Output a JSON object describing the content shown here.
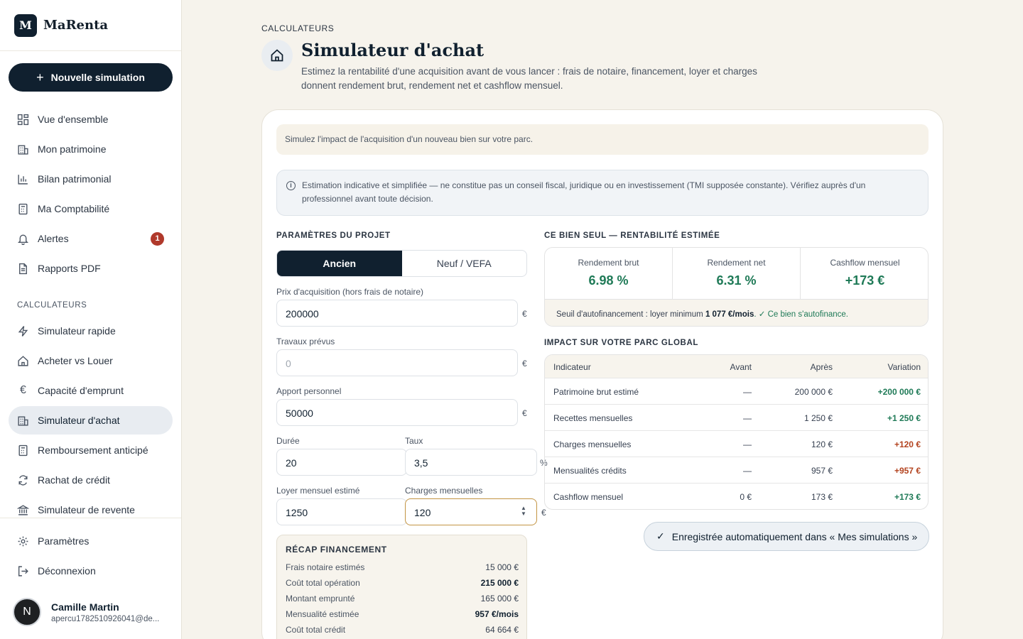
{
  "app": {
    "brand_letter": "M",
    "brand_name": "MaRenta"
  },
  "sidebar": {
    "new_button": "Nouvelle simulation",
    "items": [
      {
        "label": "Vue d'ensemble",
        "icon": "grid-icon"
      },
      {
        "label": "Mon patrimoine",
        "icon": "building-icon"
      },
      {
        "label": "Bilan patrimonial",
        "icon": "bar-chart-icon"
      },
      {
        "label": "Ma Comptabilité",
        "icon": "calculator-icon"
      },
      {
        "label": "Alertes",
        "icon": "bell-icon",
        "badge": "1"
      },
      {
        "label": "Rapports PDF",
        "icon": "file-icon"
      }
    ],
    "calc_section": "CALCULATEURS",
    "calc_items": [
      {
        "label": "Simulateur rapide",
        "icon": "lightning-icon"
      },
      {
        "label": "Acheter vs Louer",
        "icon": "home-icon"
      },
      {
        "label": "Capacité d'emprunt",
        "icon": "euro-icon"
      },
      {
        "label": "Simulateur d'achat",
        "icon": "building-icon",
        "active": true
      },
      {
        "label": "Remboursement anticipé",
        "icon": "calculator-icon"
      },
      {
        "label": "Rachat de crédit",
        "icon": "refresh-icon"
      },
      {
        "label": "Simulateur de revente",
        "icon": "bank-icon"
      }
    ],
    "settings": "Paramètres",
    "logout": "Déconnexion",
    "user": {
      "initial": "N",
      "name": "Camille Martin",
      "email": "apercu1782510926041@de..."
    }
  },
  "header": {
    "eyebrow": "CALCULATEURS",
    "title": "Simulateur d'achat",
    "subtitle": "Estimez la rentabilité d'une acquisition avant de vous lancer : frais de notaire, financement, loyer et charges donnent rendement brut, rendement net et cashflow mensuel."
  },
  "notice": "Simulez l'impact de l'acquisition d'un nouveau bien sur votre parc.",
  "disclaimer": "Estimation indicative et simplifiée — ne constitue pas un conseil fiscal, juridique ou en investissement (TMI supposée constante). Vérifiez auprès d'un professionnel avant toute décision.",
  "params": {
    "title": "PARAMÈTRES DU PROJET",
    "toggle": {
      "on": "Ancien",
      "off": "Neuf / VEFA"
    },
    "prix": {
      "label": "Prix d'acquisition (hors frais de notaire)",
      "value": "200000",
      "unit": "€"
    },
    "travaux": {
      "label": "Travaux prévus",
      "placeholder": "0",
      "unit": "€"
    },
    "apport": {
      "label": "Apport personnel",
      "value": "50000",
      "unit": "€"
    },
    "duree": {
      "label": "Durée",
      "value": "20"
    },
    "taux": {
      "label": "Taux",
      "value": "3,5",
      "unit": "%"
    },
    "loyer": {
      "label": "Loyer mensuel estimé",
      "value": "1250"
    },
    "charges": {
      "label": "Charges mensuelles",
      "value": "120",
      "unit": "€"
    }
  },
  "recap": {
    "title": "RÉCAP FINANCEMENT",
    "rows": [
      {
        "label": "Frais notaire estimés",
        "value": "15 000 €",
        "bold": false
      },
      {
        "label": "Coût total opération",
        "value": "215 000 €",
        "bold": true
      },
      {
        "label": "Montant emprunté",
        "value": "165 000 €",
        "bold": false
      },
      {
        "label": "Mensualité estimée",
        "value": "957 €/mois",
        "bold": true
      },
      {
        "label": "Coût total crédit",
        "value": "64 664 €",
        "bold": false
      }
    ]
  },
  "rentab": {
    "title": "CE BIEN SEUL — RENTABILITÉ ESTIMÉE",
    "kpis": [
      {
        "label": "Rendement brut",
        "value": "6.98 %"
      },
      {
        "label": "Rendement net",
        "value": "6.31 %"
      },
      {
        "label": "Cashflow mensuel",
        "value": "+173 €"
      }
    ],
    "foot_prefix": "Seuil d'autofinancement : loyer minimum ",
    "foot_value": "1 077 €/mois",
    "foot_ok": ". ✓ Ce bien s'autofinance."
  },
  "impact": {
    "title": "IMPACT SUR VOTRE PARC GLOBAL",
    "headers": [
      "Indicateur",
      "Avant",
      "Après",
      "Variation"
    ],
    "rows": [
      {
        "label": "Patrimoine brut estimé",
        "avant": "—",
        "apres": "200 000 €",
        "var": "+200 000 €",
        "tone": "pos"
      },
      {
        "label": "Recettes mensuelles",
        "avant": "—",
        "apres": "1 250 €",
        "var": "+1 250 €",
        "tone": "pos"
      },
      {
        "label": "Charges mensuelles",
        "avant": "—",
        "apres": "120 €",
        "var": "+120 €",
        "tone": "neg"
      },
      {
        "label": "Mensualités crédits",
        "avant": "—",
        "apres": "957 €",
        "var": "+957 €",
        "tone": "neg"
      },
      {
        "label": "Cashflow mensuel",
        "avant": "0 €",
        "apres": "173 €",
        "var": "+173 €",
        "tone": "pos"
      }
    ]
  },
  "saved_button": "Enregistrée automatiquement dans « Mes simulations »"
}
